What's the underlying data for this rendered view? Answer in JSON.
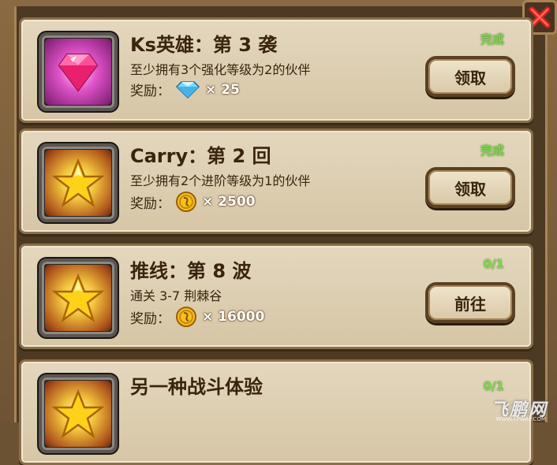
{
  "quests": [
    {
      "title": "Ks英雄：第 3 袭",
      "description": "至少拥有3个强化等级为2的伙伴",
      "reward_label": "奖励：",
      "reward_icon": "diamond-icon",
      "reward_amount": "× 25",
      "status": "完成",
      "button_label": "领取",
      "icon": "pink-gem-icon"
    },
    {
      "title": "Carry：第 2 回",
      "description": "至少拥有2个进阶等级为1的伙伴",
      "reward_label": "奖励：",
      "reward_icon": "gold-coin-icon",
      "reward_amount": "× 2500",
      "status": "完成",
      "button_label": "领取",
      "icon": "gold-star-icon"
    },
    {
      "title": "推线：第 8 波",
      "description": "通关 3-7 荆棘谷",
      "reward_label": "奖励：",
      "reward_icon": "gold-coin-icon",
      "reward_amount": "× 16000",
      "status": "0/1",
      "button_label": "前往",
      "icon": "gold-star-icon"
    },
    {
      "title": "另一种战斗体验",
      "status": "0/1",
      "icon": "gold-star-icon"
    }
  ],
  "watermark": {
    "text": "飞鹏网",
    "sub": "WWW.FPWAP.COM"
  },
  "colors": {
    "status_green": "#7ed94e",
    "card_bg": "#e4d7bd",
    "frame": "#8c6e48",
    "text": "#3a2410"
  }
}
